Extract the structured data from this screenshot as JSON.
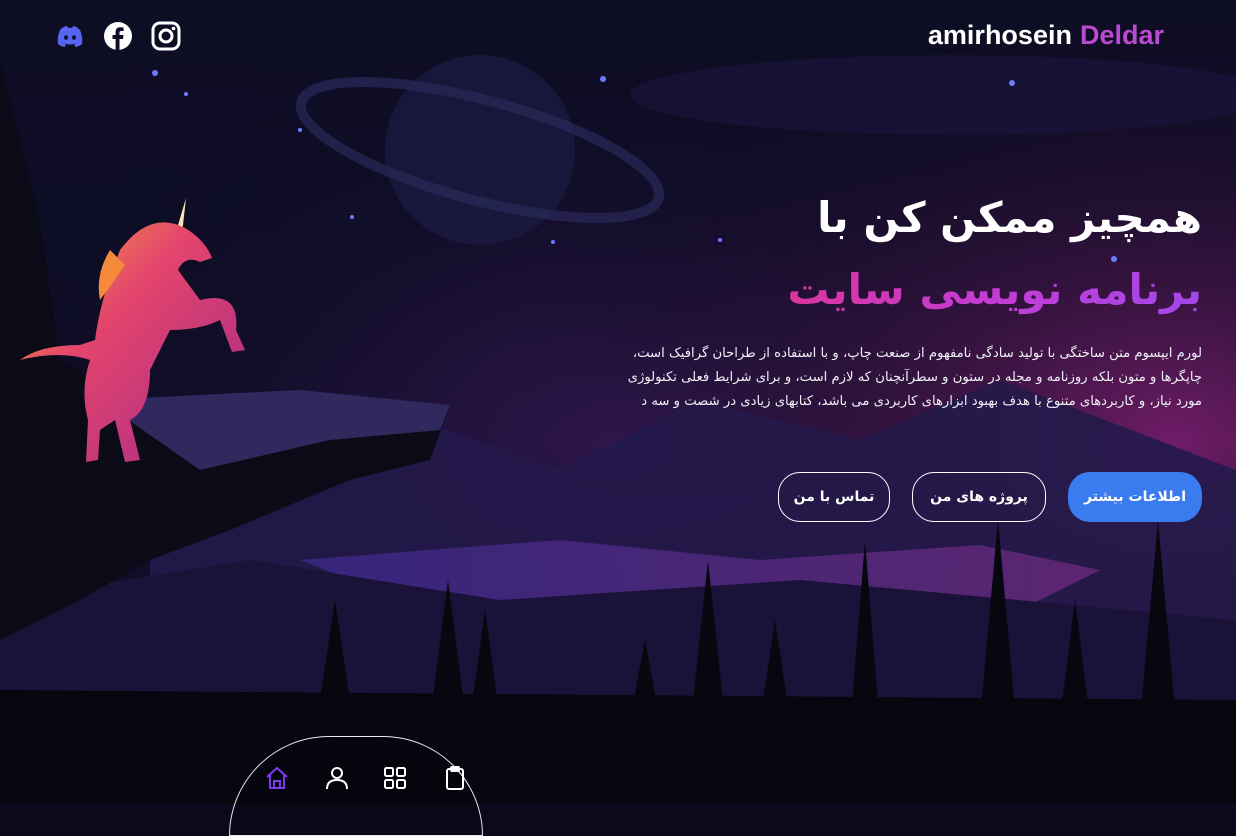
{
  "header": {
    "brand_first": "amirhosein",
    "brand_last": "Deldar",
    "social": [
      {
        "icon": "discord-icon",
        "color": "#5865f2"
      },
      {
        "icon": "facebook-icon",
        "color": "#ffffff"
      },
      {
        "icon": "instagram-icon",
        "color": "#ffffff"
      }
    ]
  },
  "hero": {
    "title_line1": "همچیز ممکن کن با",
    "title_line2": "برنامه نویسی سایت",
    "description": "لورم ایپسوم متن ساختگی با تولید سادگی نامفهوم از صنعت چاپ، و با استفاده از طراحان گرافیک است، چاپگرها و متون بلکه روزنامه و مجله در ستون و سطرآنچنان که لازم است، و برای شرایط فعلی تکنولوژی مورد نیاز، و کاربردهای متنوع با هدف بهبود ابزارهای کاربردی می باشد، کتابهای زیادی در شصت و سه د"
  },
  "buttons": {
    "more_info": "اطلاعات بیشتر",
    "my_projects": "پروژه های من",
    "contact_me": "تماس با من"
  },
  "bottom_nav": {
    "items": [
      "home-icon",
      "user-icon",
      "grid-icon",
      "clipboard-icon"
    ],
    "active_color": "#7c3aed"
  },
  "colors": {
    "accent": "#b94ad1",
    "primary_button": "#3b7bf0",
    "background": "#0a0a1c"
  }
}
